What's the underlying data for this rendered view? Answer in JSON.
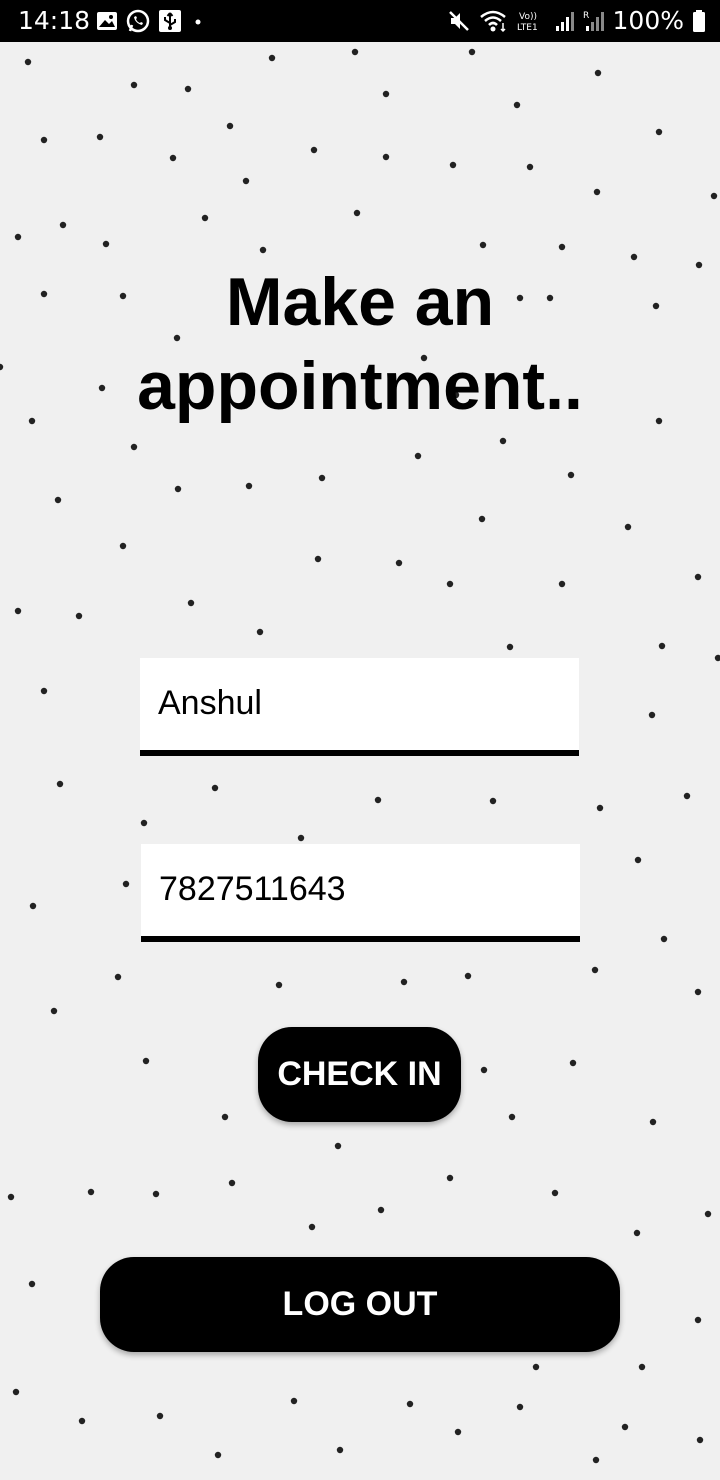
{
  "status_bar": {
    "time": "14:18",
    "battery": "100%",
    "left_icons": [
      "image-icon",
      "whatsapp-icon",
      "usb-icon",
      "dot-icon"
    ],
    "right_icons": [
      "mute-icon",
      "wifi-icon",
      "volte-icon",
      "signal-icon",
      "signal-icon-2",
      "battery-icon"
    ]
  },
  "title": "Make an appointment..",
  "form": {
    "name_value": "Anshul",
    "phone_value": "7827511643"
  },
  "buttons": {
    "checkin_label": "CHECK IN",
    "logout_label": "LOG OUT"
  },
  "colors": {
    "background": "#f0f0f0",
    "accent": "#000000",
    "field_bg": "#ffffff"
  }
}
